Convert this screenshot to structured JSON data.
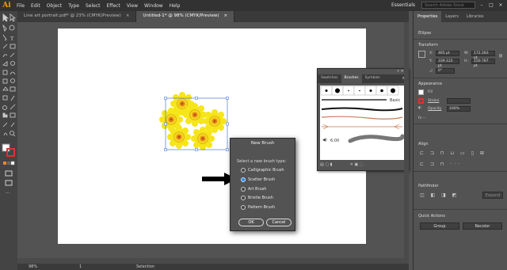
{
  "app": {
    "logo": "Ai"
  },
  "menu": [
    "File",
    "Edit",
    "Object",
    "Type",
    "Select",
    "Effect",
    "View",
    "Window",
    "Help"
  ],
  "workspace": "Essentials",
  "search_placeholder": "Search Adobe Stock",
  "window_controls": {
    "minimize": "–",
    "maximize": "□",
    "close": "×"
  },
  "tabs": [
    {
      "label": "Line art portrait.pdf* @ 23% (CMYK/Preview)",
      "close": "×",
      "active": false
    },
    {
      "label": "Untitled-1* @ 98% (CMYK/Preview)",
      "close": "×",
      "active": true
    }
  ],
  "status": {
    "zoom": "98%",
    "page": "1",
    "selection": "Selection"
  },
  "properties": {
    "tabs": [
      "Properties",
      "Layers",
      "Libraries"
    ],
    "object_type": "Ellipse",
    "transform": {
      "title": "Transform",
      "x_label": "X:",
      "x": "465 pt",
      "y_label": "Y:",
      "y": "339.122 pt",
      "w_label": "W:",
      "w": "172.283 pt",
      "h_label": "H:",
      "h": "150.787 pt",
      "angle": "0°"
    },
    "appearance": {
      "title": "Appearance",
      "fill": "Fill",
      "stroke": "Stroke",
      "stroke_weight": "",
      "opacity": "Opacity",
      "opacity_value": "100%"
    },
    "align": {
      "title": "Align"
    },
    "pathfinder": {
      "title": "Pathfinder",
      "expand": "Expand"
    },
    "quick_actions": {
      "title": "Quick Actions",
      "group": "Group",
      "recolor": "Recolor"
    }
  },
  "brushes_panel": {
    "tabs": [
      "Swatches",
      "Brushes",
      "Symbols"
    ],
    "basic_label": "Basic",
    "size_value": "6.00"
  },
  "dialog": {
    "title": "New Brush",
    "prompt": "Select a new brush type:",
    "options": [
      {
        "label": "Calligraphic Brush",
        "selected": false
      },
      {
        "label": "Scatter Brush",
        "selected": true
      },
      {
        "label": "Art Brush",
        "selected": false
      },
      {
        "label": "Bristle Brush",
        "selected": false
      },
      {
        "label": "Pattern Brush",
        "selected": false
      }
    ],
    "ok": "OK",
    "cancel": "Cancel"
  },
  "colors": {
    "accent": "#2d8ceb",
    "flower_petal": "#f5e51a",
    "flower_center": "#e88a1c",
    "fill_swatch": "#ffffff",
    "stroke_swatch": "#e03030",
    "logo": "#ff9a00"
  }
}
